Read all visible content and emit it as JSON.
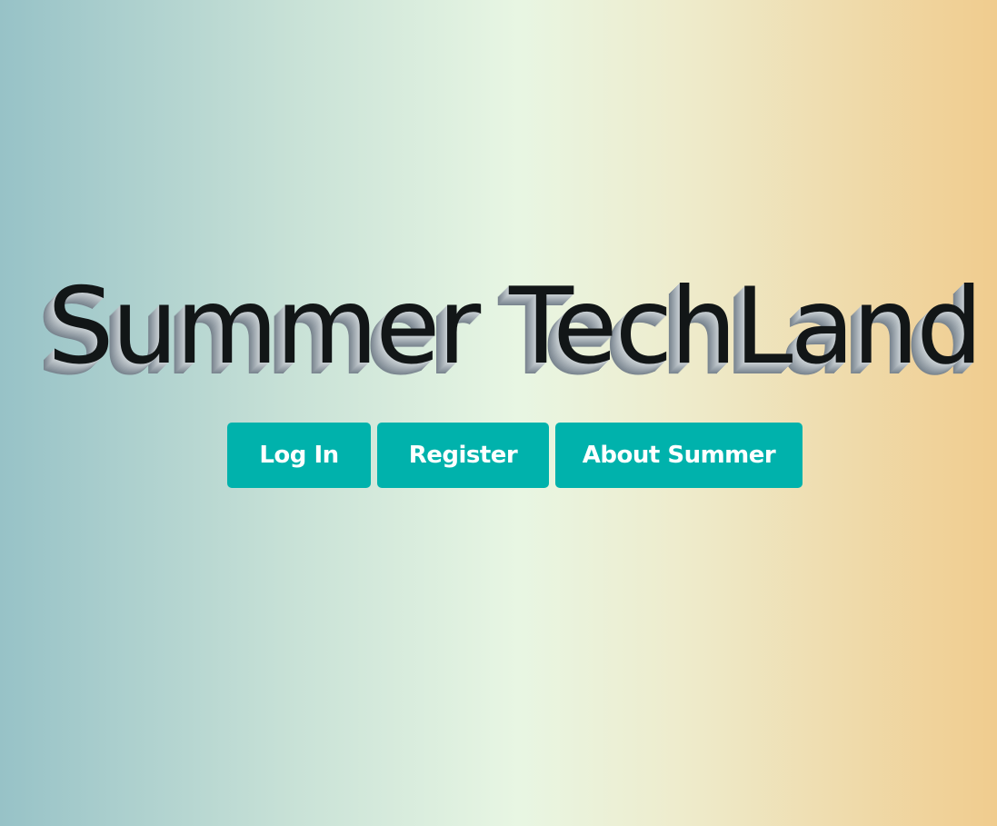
{
  "hero": {
    "title": "Summer TechLand"
  },
  "nav": {
    "login_label": "Log In",
    "register_label": "Register",
    "about_label": "About Summer"
  },
  "colors": {
    "button_bg": "#00b2ac",
    "button_text": "#ffffff",
    "title_text": "#121617",
    "gradient_left": "#97c2c7",
    "gradient_center": "#e8f6e3",
    "gradient_right": "#f0cc8e"
  }
}
